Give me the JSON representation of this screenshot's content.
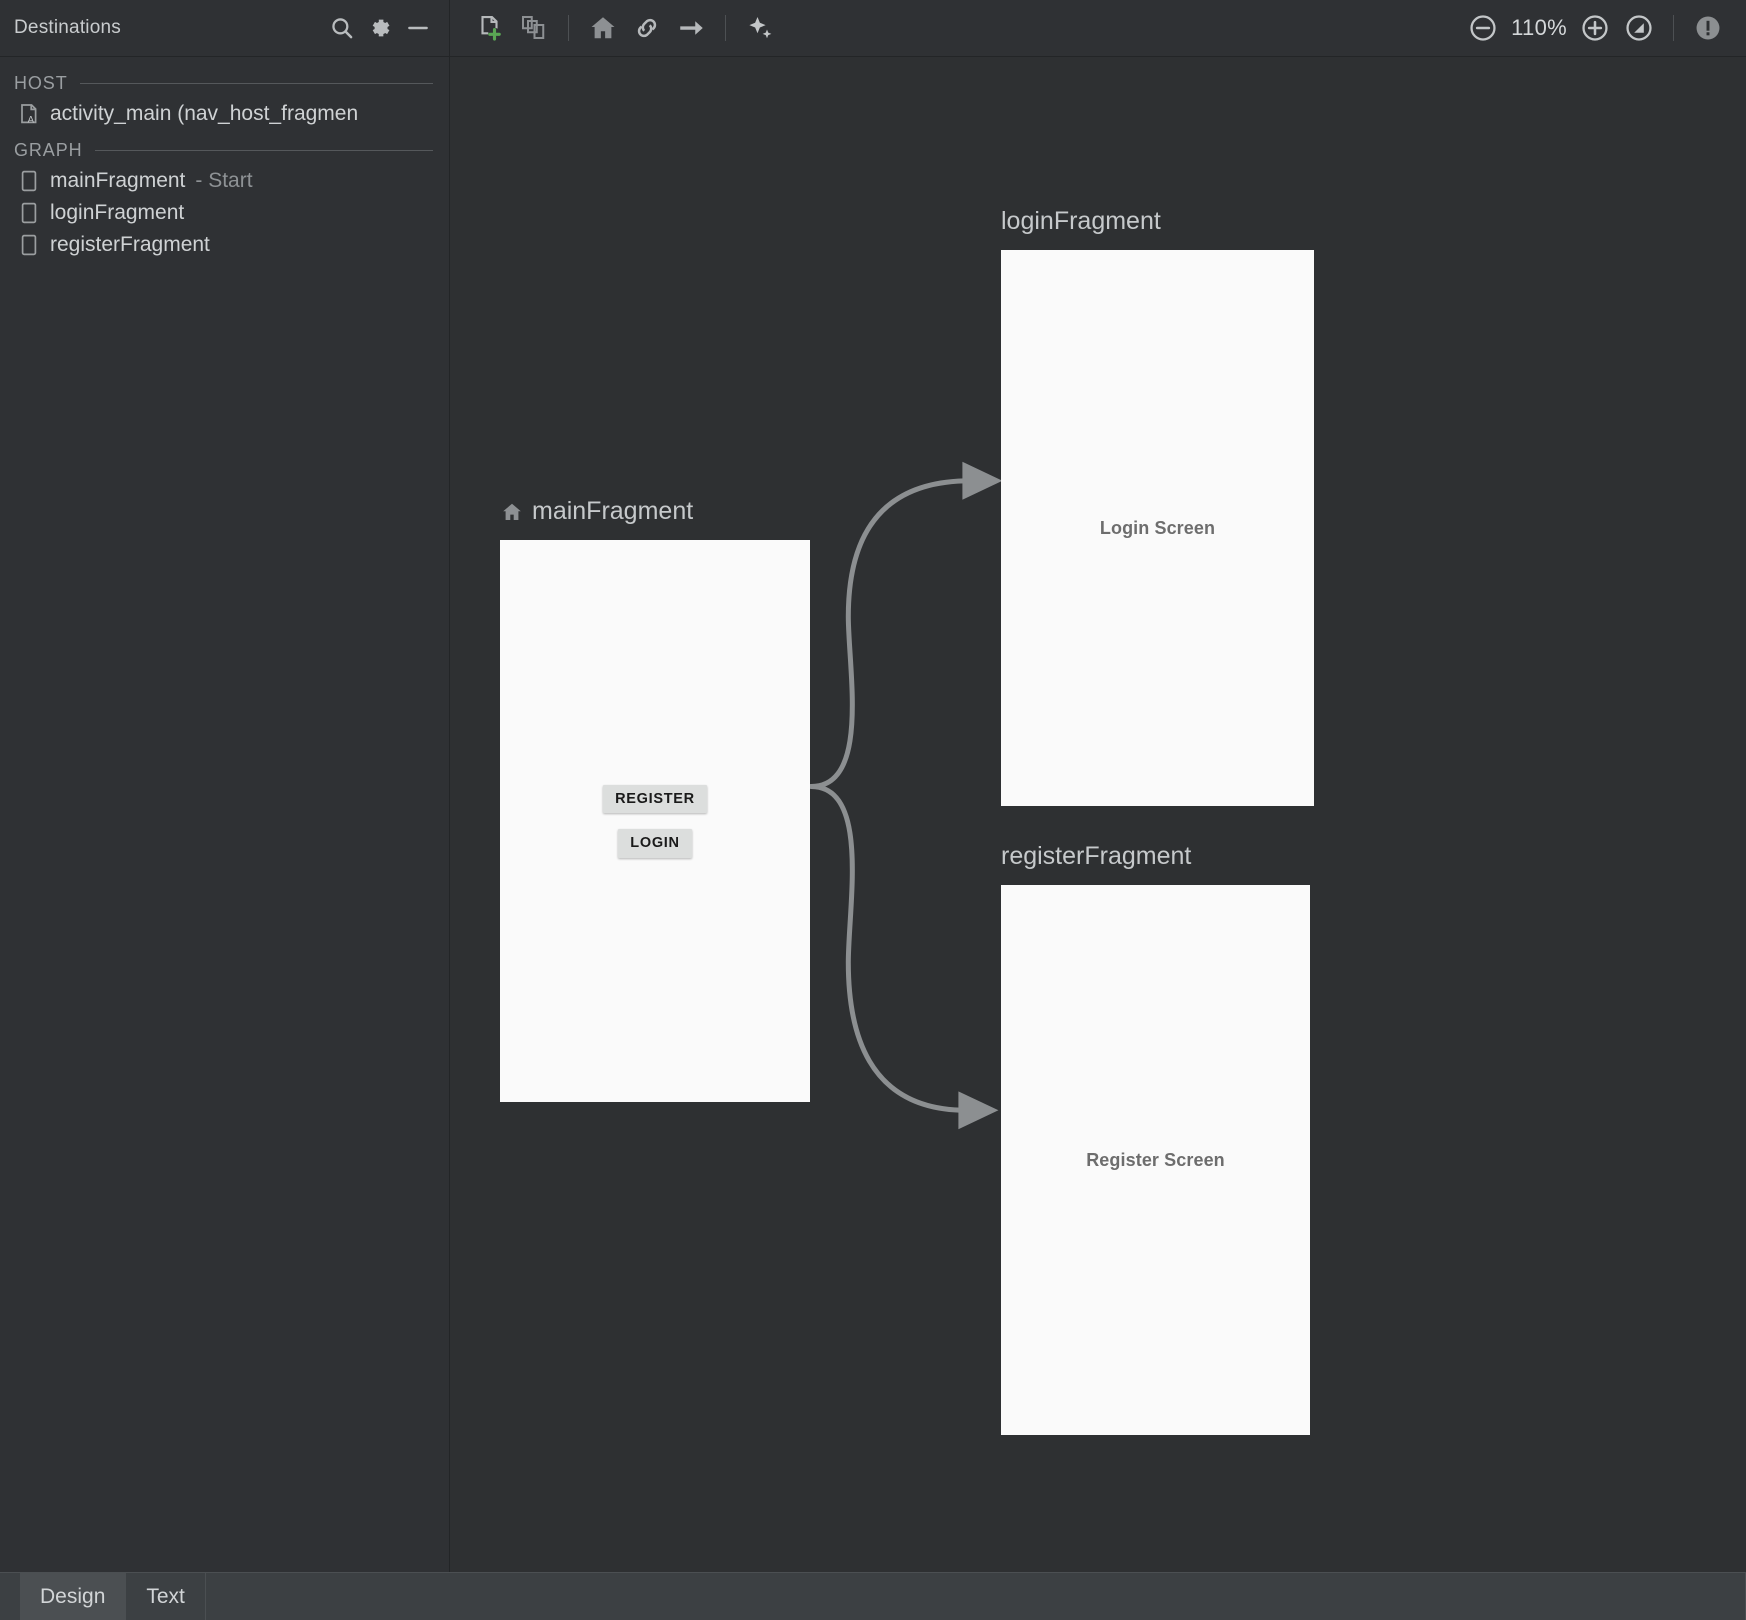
{
  "sidebar": {
    "title": "Destinations",
    "header_actions": [
      {
        "name": "search-icon",
        "label": "Search"
      },
      {
        "name": "gear-icon",
        "label": "Settings"
      },
      {
        "name": "minimize-icon",
        "label": "Hide"
      }
    ],
    "sections": [
      {
        "label": "HOST",
        "items": [
          {
            "label": "activity_main (nav_host_fragmen",
            "suffix": "",
            "icon": "activity-icon"
          }
        ]
      },
      {
        "label": "GRAPH",
        "items": [
          {
            "label": "mainFragment",
            "suffix": " - Start",
            "icon": "fragment-icon"
          },
          {
            "label": "loginFragment",
            "suffix": "",
            "icon": "fragment-icon"
          },
          {
            "label": "registerFragment",
            "suffix": "",
            "icon": "fragment-icon"
          }
        ]
      }
    ]
  },
  "toolbar": {
    "new_destination_label": "New Destination",
    "nested_graph_label": "Nested Graph",
    "set_start_destination_label": "Set Start Destination",
    "deep_link_label": "Add Deep Link",
    "action_label": "Add Action",
    "assistant_label": "Gemini Assistant",
    "zoom_out_label": "Zoom Out",
    "zoom_level": "110%",
    "zoom_in_label": "Zoom In",
    "zoom_fit_label": "Zoom to Fit",
    "issues_label": "Issues"
  },
  "canvas": {
    "nodes": [
      {
        "id": "mainFragment",
        "title": "mainFragment",
        "is_start": true,
        "start_icon": "home-icon",
        "screen_label": "",
        "buttons": [
          "REGISTER",
          "LOGIN"
        ]
      },
      {
        "id": "loginFragment",
        "title": "loginFragment",
        "is_start": false,
        "start_icon": "",
        "screen_label": "Login Screen",
        "buttons": []
      },
      {
        "id": "registerFragment",
        "title": "registerFragment",
        "is_start": false,
        "start_icon": "",
        "screen_label": "Register Screen",
        "buttons": []
      }
    ],
    "edges": [
      {
        "from": "mainFragment",
        "to": "loginFragment"
      },
      {
        "from": "mainFragment",
        "to": "registerFragment"
      }
    ]
  },
  "bottom_tabs": {
    "tabs": [
      {
        "label": "Design",
        "selected": true
      },
      {
        "label": "Text",
        "selected": false
      }
    ]
  },
  "colors": {
    "background": "#2e3032",
    "panel": "#2f3134",
    "edge": "#8c8f91",
    "accent_green": "#5aa654",
    "preview": "#fafafa"
  }
}
